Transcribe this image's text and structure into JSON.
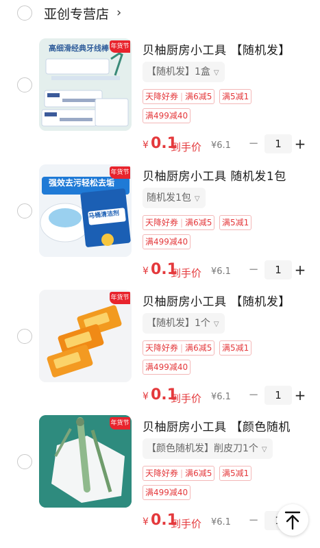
{
  "shop": {
    "name": "亚创专营店",
    "chevron": "›"
  },
  "items": [
    {
      "title": "贝柚厨房小工具 【随机发】",
      "spec": "【随机发】1盒",
      "tag_coupon": "天降好券",
      "tag_deal1": "满6减5",
      "tag_deal2": "满5减1",
      "tag_deal3": "满499减40",
      "price_currency": "¥",
      "price_value": "0.1",
      "price_suffix": "到手价",
      "orig_price": "¥6.1",
      "qty": "1",
      "minus": "−",
      "plus": "+",
      "badge": "年货节",
      "image_text": "高细滑经典牙线棒"
    },
    {
      "title": "贝柚厨房小工具 随机发1包",
      "spec": "随机发1包",
      "tag_coupon": "天降好券",
      "tag_deal1": "满6减5",
      "tag_deal2": "满5减1",
      "tag_deal3": "满499减40",
      "price_currency": "¥",
      "price_value": "0.1",
      "price_suffix": "到手价",
      "orig_price": "¥6.1",
      "qty": "1",
      "minus": "−",
      "plus": "+",
      "badge": "年货节",
      "image_text": "强效去污轻松去垢",
      "image_text2": "马桶清洁剂"
    },
    {
      "title": "贝柚厨房小工具 【随机发】",
      "spec": "【随机发】1个",
      "tag_coupon": "天降好券",
      "tag_deal1": "满6减5",
      "tag_deal2": "满5减1",
      "tag_deal3": "满499减40",
      "price_currency": "¥",
      "price_value": "0.1",
      "price_suffix": "到手价",
      "orig_price": "¥6.1",
      "qty": "1",
      "minus": "−",
      "plus": "+",
      "badge": "年货节"
    },
    {
      "title": "贝柚厨房小工具 【颜色随机",
      "spec": "【颜色随机发】削皮刀1个",
      "tag_coupon": "天降好券",
      "tag_deal1": "满6减5",
      "tag_deal2": "满5减1",
      "tag_deal3": "满499减40",
      "price_currency": "¥",
      "price_value": "0.1",
      "price_suffix": "到手价",
      "orig_price": "¥6.1",
      "qty": "1",
      "minus": "−",
      "plus": "+",
      "badge": "年货节"
    }
  ],
  "colors": {
    "accent": "#e4393c",
    "tag_border": "#f3b7b7",
    "qty_bg": "#f5f5f5"
  },
  "icons": {
    "back_to_top": "arrow-up-to-line-icon"
  }
}
